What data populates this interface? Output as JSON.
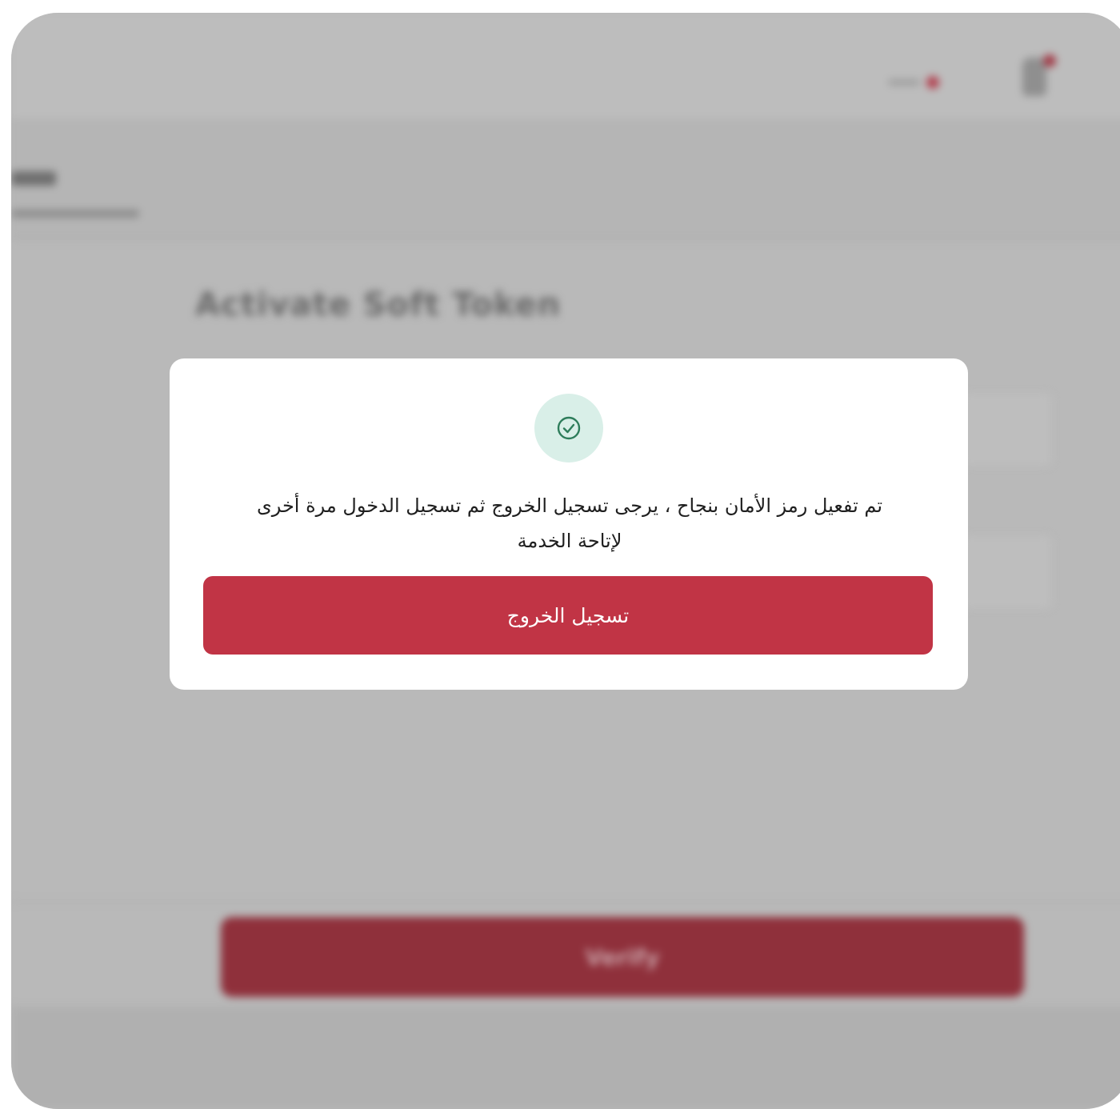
{
  "background": {
    "page_title": "Activate Soft Token",
    "verify_button_label": "Verify"
  },
  "modal": {
    "icon": "check-circle-icon",
    "message": "تم تفعيل رمز الأمان بنجاح ، يرجى تسجيل الخروج ثم تسجيل الدخول مرة أخرى لإتاحة الخدمة",
    "logout_button_label": "تسجيل الخروج"
  },
  "colors": {
    "overlay": "#b9b9b9",
    "primary_button": "#c13445",
    "success_icon_bg": "#d9efe8",
    "success_icon_stroke": "#2e7d5b"
  }
}
